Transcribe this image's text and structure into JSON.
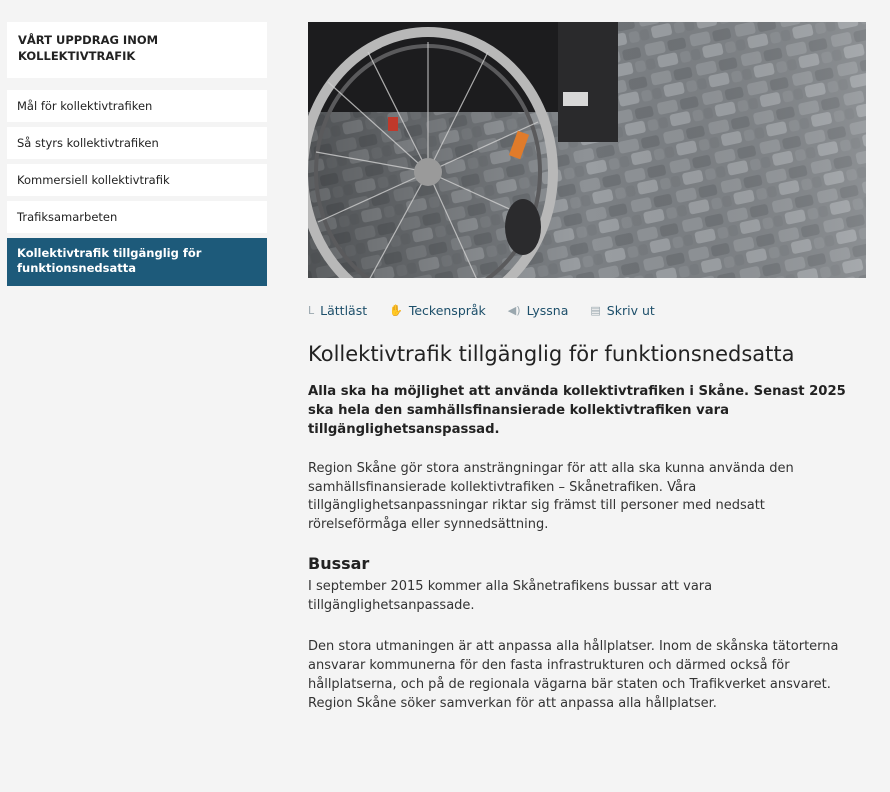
{
  "sidebar": {
    "heading": "VÅRT UPPDRAG INOM KOLLEKTIVTRAFIK",
    "items": [
      {
        "label": "Mål för kollektivtrafiken"
      },
      {
        "label": "Så styrs kollektivtrafiken"
      },
      {
        "label": "Kommersiell kollektivtrafik"
      },
      {
        "label": "Trafiksamarbeten"
      },
      {
        "label": "Kollektivtrafik tillgänglig för funktionsnedsatta"
      }
    ]
  },
  "toolbar": {
    "easy_read": "Lättläst",
    "sign_language": "Teckenspråk",
    "listen": "Lyssna",
    "print": "Skriv ut"
  },
  "article": {
    "title": "Kollektivtrafik tillgänglig för funktionsnedsatta",
    "lead": "Alla ska ha möjlighet att använda kollektivtrafiken i Skåne. Senast 2025 ska hela den samhällsfinansierade kollektivtrafiken vara tillgänglighetsanspassad.",
    "paragraph1": "Region Skåne gör stora ansträngningar för att alla ska kunna använda den samhällsfinansierade kollektivtrafiken – Skånetrafiken. Våra tillgänglighetsanpassningar riktar sig främst till personer med nedsatt rörelseförmåga eller synnedsättning.",
    "section_heading": "Bussar",
    "paragraph2": "I september 2015 kommer alla Skånetrafikens bussar att vara tillgänglighetsanpassade.",
    "paragraph3": "Den stora utmaningen är att anpassa alla hållplatser. Inom de skånska tätorterna ansvarar kommunerna för den fasta infrastrukturen och därmed också för hållplatserna, och på de regionala vägarna bär staten och Trafikverket ansvaret. Region Skåne söker samverkan för att anpassa alla hållplatser."
  },
  "colors": {
    "active_nav": "#1d5a7a",
    "link": "#1d4f6a",
    "page_bg": "#f4f4f4"
  }
}
